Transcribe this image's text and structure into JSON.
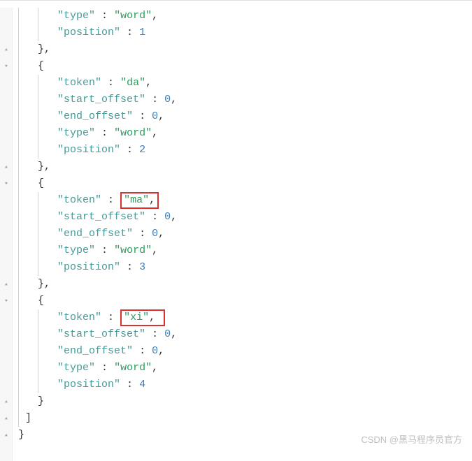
{
  "code": {
    "indent1": "      ",
    "indent2": "    ",
    "indent3": "  ",
    "obj1": {
      "type_key": "\"type\"",
      "type_val": "\"word\"",
      "position_key": "\"position\"",
      "position_val": "1"
    },
    "obj2": {
      "token_key": "\"token\"",
      "token_val": "\"da\"",
      "start_offset_key": "\"start_offset\"",
      "start_offset_val": "0",
      "end_offset_key": "\"end_offset\"",
      "end_offset_val": "0",
      "type_key": "\"type\"",
      "type_val": "\"word\"",
      "position_key": "\"position\"",
      "position_val": "2"
    },
    "obj3": {
      "token_key": "\"token\"",
      "token_val": "\"ma\"",
      "start_offset_key": "\"start_offset\"",
      "start_offset_val": "0",
      "end_offset_key": "\"end_offset\"",
      "end_offset_val": "0",
      "type_key": "\"type\"",
      "type_val": "\"word\"",
      "position_key": "\"position\"",
      "position_val": "3"
    },
    "obj4": {
      "token_key": "\"token\"",
      "token_val": "\"xi\"",
      "start_offset_key": "\"start_offset\"",
      "start_offset_val": "0",
      "end_offset_key": "\"end_offset\"",
      "end_offset_val": "0",
      "type_key": "\"type\"",
      "type_val": "\"word\"",
      "position_key": "\"position\"",
      "position_val": "4"
    },
    "close_brace_comma": "},",
    "open_brace": "{",
    "close_brace": "}",
    "close_bracket": "]",
    "colon": " : ",
    "comma": ","
  },
  "watermark": "CSDN @黑马程序员官方"
}
